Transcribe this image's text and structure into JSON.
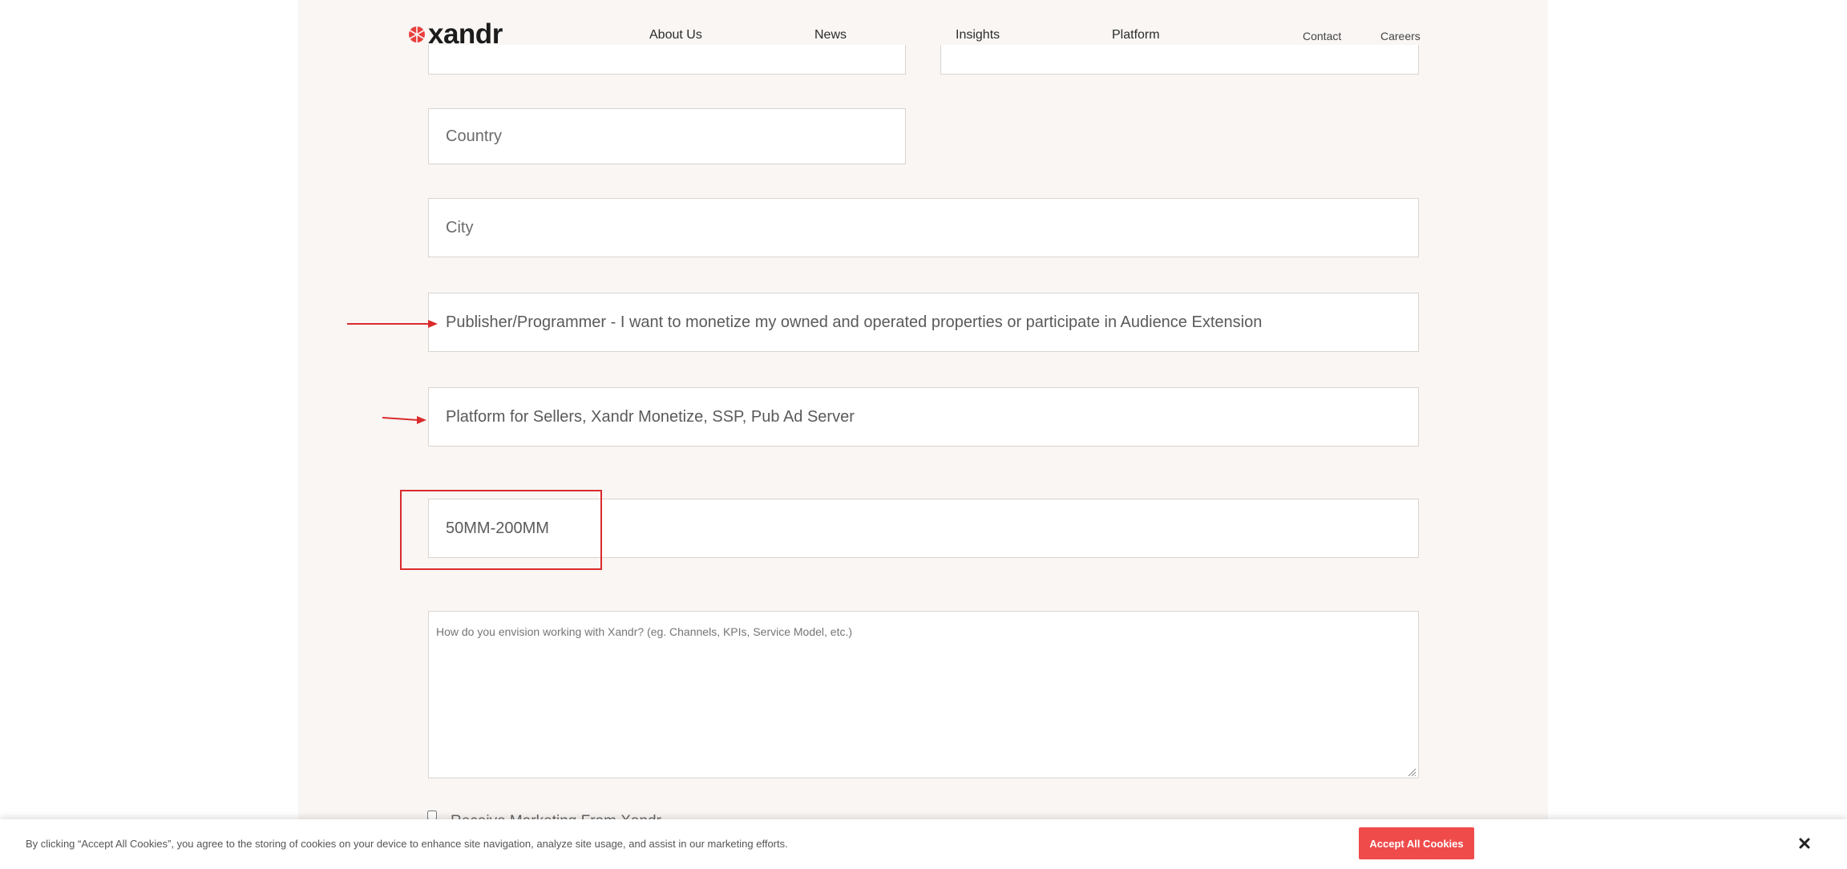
{
  "header": {
    "logo_text": "xandr",
    "nav": {
      "about": "About Us",
      "news": "News",
      "insights": "Insights",
      "platform": "Platform",
      "contact": "Contact",
      "careers": "Careers"
    }
  },
  "form": {
    "country_placeholder": "Country",
    "city_placeholder": "City",
    "company_type_value": "Publisher/Programmer - I want to monetize my owned and operated properties or participate in Audience Extension",
    "product_interest_value": "Platform for Sellers, Xandr Monetize, SSP, Pub Ad Server",
    "revenue_value": "50MM-200MM",
    "message_placeholder": "How do you envision working with Xandr? (eg. Channels, KPIs, Service Model, etc.)",
    "checkbox_label": "Receive Marketing From Xandr"
  },
  "cookie_banner": {
    "text": "By clicking “Accept All Cookies”, you agree to the storing of cookies on your device to enhance site navigation, analyze site usage, and assist in our marketing efforts.",
    "accept_label": "Accept All Cookies"
  },
  "colors": {
    "brand_red": "#e8403d",
    "accept_button": "#f04b4b",
    "annotation_red": "#d92b2b",
    "page_background": "#f9f6f4"
  },
  "icons": {
    "logo": "xandr-logo-icon",
    "close": "close-icon",
    "resize": "resize-grip-icon"
  }
}
